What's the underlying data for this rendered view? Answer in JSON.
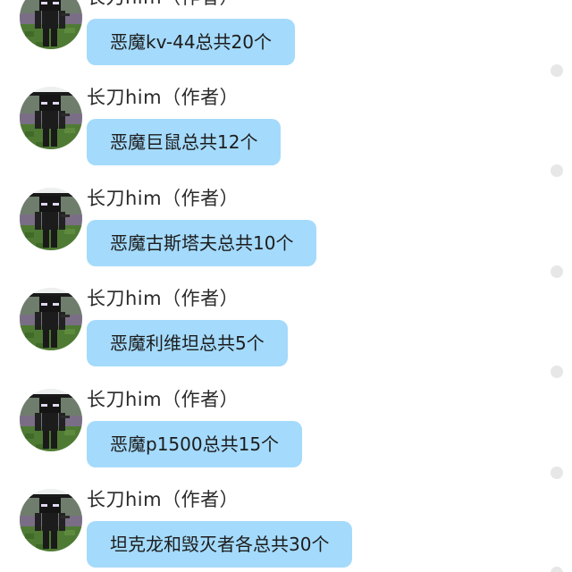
{
  "messages": [
    {
      "sender": "长刀him（作者）",
      "text": "恶魔kv-44总共20个"
    },
    {
      "sender": "长刀him（作者）",
      "text": "恶魔巨鼠总共12个"
    },
    {
      "sender": "长刀him（作者）",
      "text": "恶魔古斯塔夫总共10个"
    },
    {
      "sender": "长刀him（作者）",
      "text": "恶魔利维坦总共5个"
    },
    {
      "sender": "长刀him（作者）",
      "text": "恶魔p1500总共15个"
    },
    {
      "sender": "长刀him（作者）",
      "text": "坦克龙和毁灭者各总共30个"
    }
  ],
  "colors": {
    "bubble": "#a4dafb",
    "text": "#1c1c1c",
    "sender": "#2a2a2a",
    "unread_dot": "#e7e7e7"
  },
  "icons": {
    "avatar": "minecraft-enderman-avatar-icon",
    "status": "read-status-dot-icon"
  }
}
